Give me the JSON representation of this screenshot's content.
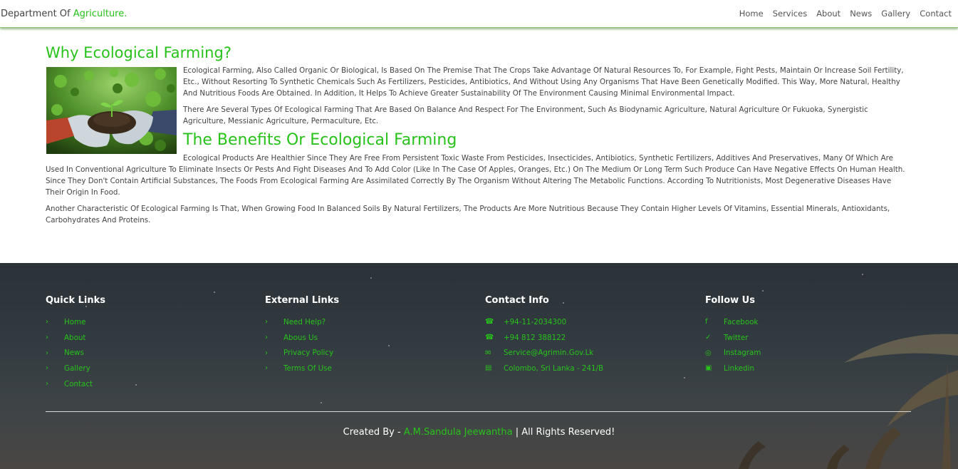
{
  "header": {
    "brand_prefix": "Department Of ",
    "brand_highlight": "Agriculture.",
    "nav": [
      "Home",
      "Services",
      "About",
      "News",
      "Gallery",
      "Contact"
    ]
  },
  "main": {
    "title": "Why Ecological Farming?",
    "paragraph1": "Ecological Farming, Also Called Organic Or Biological, Is Based On The Premise That The Crops Take Advantage Of Natural Resources To, For Example, Fight Pests, Maintain Or Increase Soil Fertility, Etc., Without Resorting To Synthetic Chemicals Such As Fertilizers, Pesticides, Antibiotics, And Without Using Any Organisms That Have Been Genetically Modified. This Way, More Natural, Healthy And Nutritious Foods Are Obtained. In Addition, It Helps To Achieve Greater Sustainability Of The Environment Causing Minimal Environmental Impact.",
    "paragraph2": "There Are Several Types Of Ecological Farming That Are Based On Balance And Respect For The Environment, Such As Biodynamic Agriculture, Natural Agriculture Or Fukuoka, Synergistic Agriculture, Messianic Agriculture, Permaculture, Etc.",
    "subtitle": "The Benefits Or Ecological Farming",
    "paragraph3": "Ecological Products Are Healthier Since They Are Free From Persistent Toxic Waste From Pesticides, Insecticides, Antibiotics, Synthetic Fertilizers, Additives And Preservatives, Many Of Which Are Used In Conventional Agriculture To Eliminate Insects Or Pests And Fight Diseases And To Add Color (Like In The Case Of Apples, Oranges, Etc.) On The Medium Or Long Term Such Produce Can Have Negative Effects On Human Health. Since They Don't Contain Artificial Substances, The Foods From Ecological Farming Are Assimilated Correctly By The Organism Without Altering The Metabolic Functions. According To Nutritionists, Most Degenerative Diseases Have Their Origin In Food.",
    "paragraph4": "Another Characteristic Of Ecological Farming Is That, When Growing Food In Balanced Soils By Natural Fertilizers, The Products Are More Nutritious Because They Contain Higher Levels Of Vitamins, Essential Minerals, Antioxidants, Carbohydrates And Proteins."
  },
  "footer": {
    "quick_links": {
      "title": "Quick Links",
      "items": [
        "Home",
        "About",
        "News",
        "Gallery",
        "Contact"
      ]
    },
    "external_links": {
      "title": "External Links",
      "items": [
        "Need Help?",
        "Abous Us",
        "Privacy Policy",
        "Terms Of Use"
      ]
    },
    "contact_info": {
      "title": "Contact Info",
      "items": [
        {
          "icon": "phone-icon",
          "text": "+94-11-2034300"
        },
        {
          "icon": "phone-icon",
          "text": "+94 812 388122"
        },
        {
          "icon": "envelope-icon",
          "text": "Service@Agrimin.Gov.Lk"
        },
        {
          "icon": "map-icon",
          "text": "Colombo, Sri Lanka - 241/B"
        }
      ]
    },
    "follow_us": {
      "title": "Follow Us",
      "items": [
        {
          "icon": "facebook-icon",
          "text": "Facebook"
        },
        {
          "icon": "twitter-icon",
          "text": "Twitter"
        },
        {
          "icon": "instagram-icon",
          "text": "Instagram"
        },
        {
          "icon": "linkedin-icon",
          "text": "Linkedin"
        }
      ]
    },
    "credit_prefix": "Created By - ",
    "credit_author": "A.M.Sandula Jeewantha",
    "credit_suffix": " | All Rights Reserved!"
  },
  "colors": {
    "accent": "#27c21a",
    "footer_bg": "#323b41",
    "text": "#444444"
  }
}
